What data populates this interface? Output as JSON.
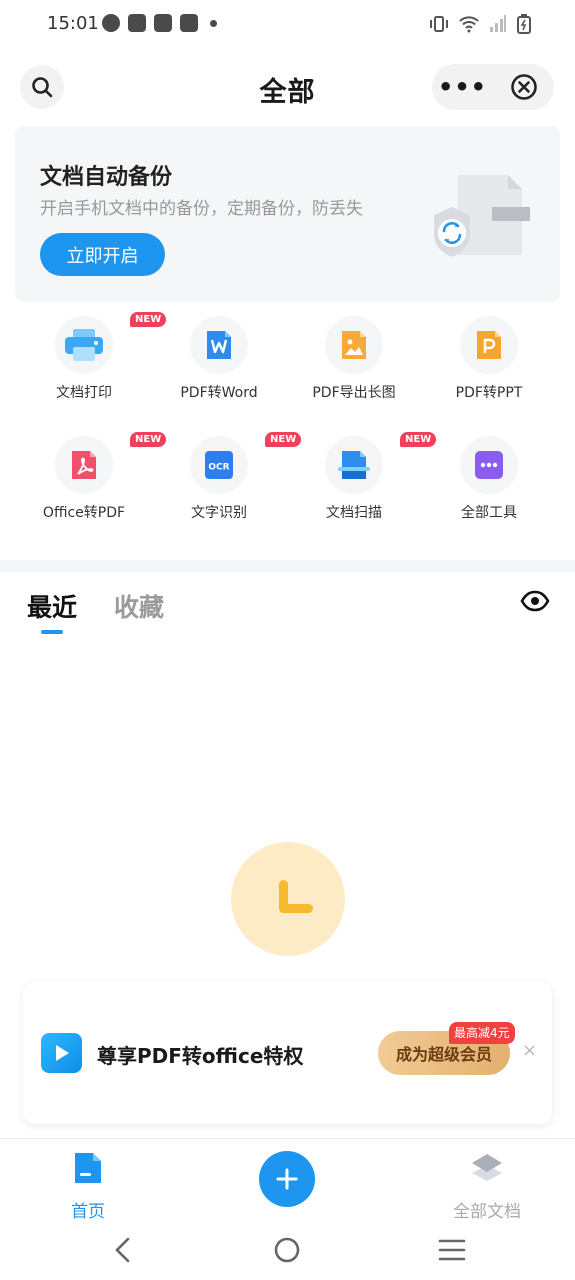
{
  "status_bar": {
    "time": "15:01",
    "left_icons": [
      "speedometer-icon",
      "bag-icon",
      "bag-icon",
      "bag-icon",
      "dot-icon"
    ],
    "right_icons": [
      "vibrate-icon",
      "wifi-icon",
      "signal-icon",
      "battery-charging-icon"
    ]
  },
  "header": {
    "title": "全部",
    "more_label": "•••"
  },
  "banner": {
    "title": "文档自动备份",
    "subtitle": "开启手机文档中的备份，定期备份，防丢失",
    "button": "立即开启"
  },
  "tools": [
    {
      "label": "文档打印",
      "badge": "NEW",
      "icon": "printer-icon",
      "color": "#3aa8f5"
    },
    {
      "label": "PDF转Word",
      "badge": "",
      "icon": "word-icon",
      "color": "#2e8cf0"
    },
    {
      "label": "PDF导出长图",
      "badge": "",
      "icon": "image-icon",
      "color": "#f7a93a"
    },
    {
      "label": "PDF转PPT",
      "badge": "",
      "icon": "ppt-icon",
      "color": "#f7a52c"
    },
    {
      "label": "Office转PDF",
      "badge": "NEW",
      "icon": "pdf-icon",
      "color": "#f2506a"
    },
    {
      "label": "文字识别",
      "badge": "NEW",
      "icon": "ocr-icon",
      "color": "#2d7ff0"
    },
    {
      "label": "文档扫描",
      "badge": "NEW",
      "icon": "scan-icon",
      "color": "#2d8ef0"
    },
    {
      "label": "全部工具",
      "badge": "",
      "icon": "more-tools-icon",
      "color": "#8a5cf0"
    }
  ],
  "tabs": {
    "recent": "最近",
    "favorites": "收藏"
  },
  "promo": {
    "text": "尊享PDF转office特权",
    "cta": "成为超级会员",
    "tag": "最高减4元",
    "close": "×"
  },
  "bottom_nav": {
    "home": "首页",
    "all_docs": "全部文档"
  },
  "colors": {
    "accent": "#1e96f0",
    "badge": "#f1405a",
    "empty_state": "#fdebc6",
    "clock": "#f6b92f"
  }
}
